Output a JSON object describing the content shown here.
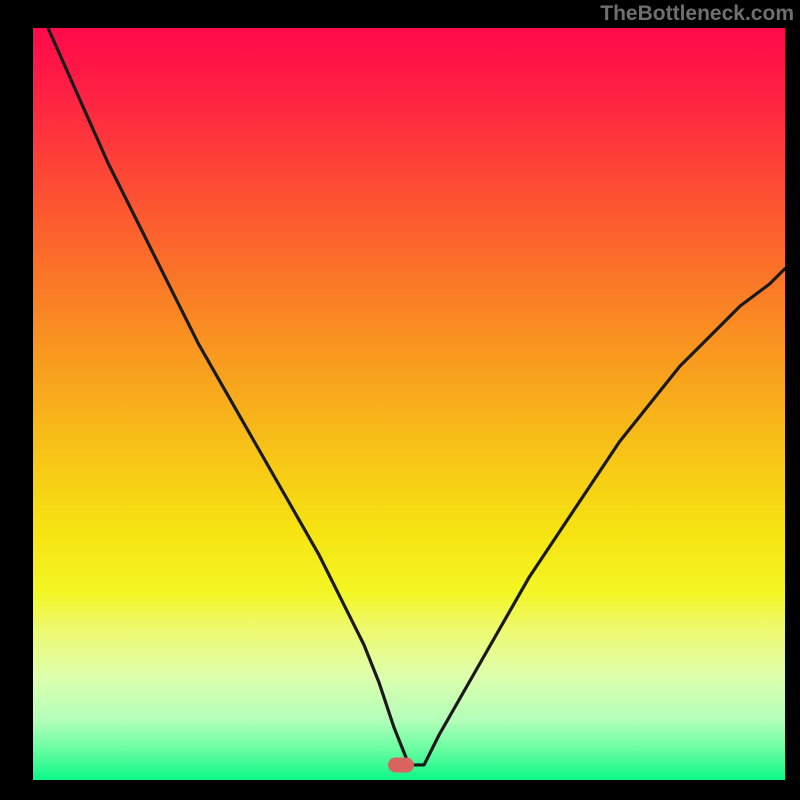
{
  "watermark": "TheBottleneck.com",
  "colors": {
    "frame_bg": "#000000",
    "watermark_text": "#6f6f6f",
    "curve_stroke": "#1a1a1a",
    "marker_fill": "#d8645f",
    "gradient_stops": [
      "#ff0a4a",
      "#ff1f44",
      "#fd4237",
      "#fb6b2a",
      "#f99420",
      "#f7c217",
      "#f6e412",
      "#f3f624",
      "#eef970",
      "#deffac",
      "#b4ffba",
      "#67fda1",
      "#0cf787"
    ]
  },
  "chart_data": {
    "type": "line",
    "title": "",
    "xlabel": "",
    "ylabel": "",
    "xlim": [
      0,
      100
    ],
    "ylim": [
      0,
      100
    ],
    "grid": false,
    "legend": false,
    "marker": {
      "x": 49,
      "y": 2
    },
    "series": [
      {
        "name": "curve",
        "x": [
          2,
          6,
          10,
          14,
          18,
          22,
          26,
          30,
          34,
          38,
          42,
          44,
          46,
          48,
          50,
          52,
          54,
          58,
          62,
          66,
          70,
          74,
          78,
          82,
          86,
          90,
          94,
          98,
          100
        ],
        "y": [
          100,
          91,
          82,
          74,
          66,
          58,
          51,
          44,
          37,
          30,
          22,
          18,
          13,
          7,
          2,
          2,
          6,
          13,
          20,
          27,
          33,
          39,
          45,
          50,
          55,
          59,
          63,
          66,
          68
        ]
      }
    ]
  }
}
